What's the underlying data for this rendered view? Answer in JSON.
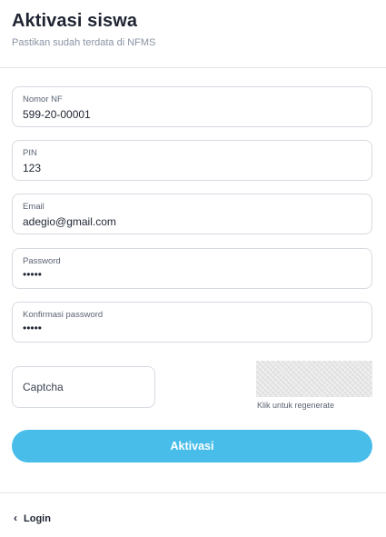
{
  "header": {
    "title": "Aktivasi siswa",
    "subtitle": "Pastikan sudah terdata di NFMS"
  },
  "form": {
    "nomor_nf": {
      "label": "Nomor NF",
      "value": "599-20-00001"
    },
    "pin": {
      "label": "PIN",
      "value": "123"
    },
    "email": {
      "label": "Email",
      "value": "adegio@gmail.com"
    },
    "password": {
      "label": "Password",
      "value": "•••••"
    },
    "konfirmasi": {
      "label": "Konfirmasi password",
      "value": "•••••"
    },
    "captcha": {
      "placeholder": "Captcha",
      "hint": "Klik untuk regenerate"
    },
    "submit_label": "Aktivasi"
  },
  "footer": {
    "back_icon": "chevron-left-icon",
    "login_label": "Login"
  },
  "colors": {
    "accent": "#48bde9",
    "border": "#d6dae1",
    "title": "#1e2431",
    "muted": "#8a93a3"
  }
}
